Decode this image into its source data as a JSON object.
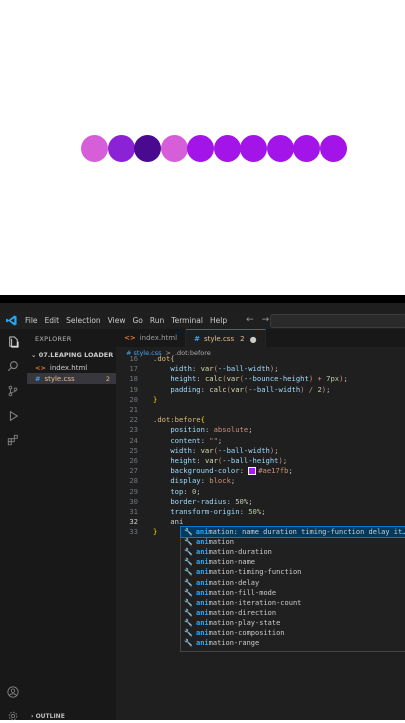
{
  "preview": {
    "dot_colors": [
      "#d65fd9",
      "#8b22d6",
      "#4a0a8f",
      "#d65fd9",
      "#a314e8",
      "#a314e8",
      "#a314e8",
      "#a314e8",
      "#a314e8",
      "#a314e8"
    ]
  },
  "titlebar": {
    "menu": [
      "File",
      "Edit",
      "Selection",
      "View",
      "Go",
      "Run",
      "Terminal",
      "Help"
    ],
    "back": "←",
    "forward": "→"
  },
  "sidebar": {
    "header": "EXPLORER",
    "folder": "07.LEAPING LOADER",
    "files": [
      {
        "icon": "<>",
        "name": "index.html",
        "badge": ""
      },
      {
        "icon": "#",
        "name": "style.css",
        "badge": "2"
      }
    ],
    "outline": "OUTLINE"
  },
  "tabs": [
    {
      "icon": "<>",
      "name": "index.html",
      "num": "",
      "modified": ""
    },
    {
      "icon": "#",
      "name": "style.css",
      "num": "2",
      "modified": "●"
    }
  ],
  "breadcrumb": {
    "file": "# style.css",
    "sep": ">",
    "symbol": ".dot:before"
  },
  "editor": {
    "lines": [
      {
        "n": "17",
        "code": "    width: var(--ball-width);"
      },
      {
        "n": "18",
        "code": "    height: calc(var(--bounce-height) + 7px);"
      },
      {
        "n": "19",
        "code": "    padding: calc(var(--ball-width) / 2);"
      },
      {
        "n": "20",
        "code": "}"
      },
      {
        "n": "21",
        "code": ""
      },
      {
        "n": "22",
        "code": ".dot:before{"
      },
      {
        "n": "23",
        "code": "    position: absolute;"
      },
      {
        "n": "24",
        "code": "    content: \"\";"
      },
      {
        "n": "25",
        "code": "    width: var(--ball-width);"
      },
      {
        "n": "26",
        "code": "    height: var(--ball-height);"
      },
      {
        "n": "27",
        "code": "    background-color: #ae17fb;"
      },
      {
        "n": "28",
        "code": "    display: block;"
      },
      {
        "n": "29",
        "code": "    top: 0;"
      },
      {
        "n": "30",
        "code": "    border-radius: 50%;"
      },
      {
        "n": "31",
        "code": "    transform-origin: 50%;"
      },
      {
        "n": "32",
        "code": "    ani"
      },
      {
        "n": "33",
        "code": "}"
      }
    ],
    "top_line_number": "16",
    "top_line_code": ".dot{"
  },
  "suggestions": [
    {
      "match": "ani",
      "rest": "mation: name duration timing-function delay it…",
      "active": true
    },
    {
      "match": "ani",
      "rest": "mation",
      "active": false
    },
    {
      "match": "ani",
      "rest": "mation-duration",
      "active": false
    },
    {
      "match": "ani",
      "rest": "mation-name",
      "active": false
    },
    {
      "match": "ani",
      "rest": "mation-timing-function",
      "active": false
    },
    {
      "match": "ani",
      "rest": "mation-delay",
      "active": false
    },
    {
      "match": "ani",
      "rest": "mation-fill-mode",
      "active": false
    },
    {
      "match": "ani",
      "rest": "mation-iteration-count",
      "active": false
    },
    {
      "match": "ani",
      "rest": "mation-direction",
      "active": false
    },
    {
      "match": "ani",
      "rest": "mation-play-state",
      "active": false
    },
    {
      "match": "ani",
      "rest": "mation-composition",
      "active": false
    },
    {
      "match": "ani",
      "rest": "mation-range",
      "active": false
    }
  ],
  "colors": {
    "accent": "#0078d4",
    "ball": "#ae17fb"
  }
}
